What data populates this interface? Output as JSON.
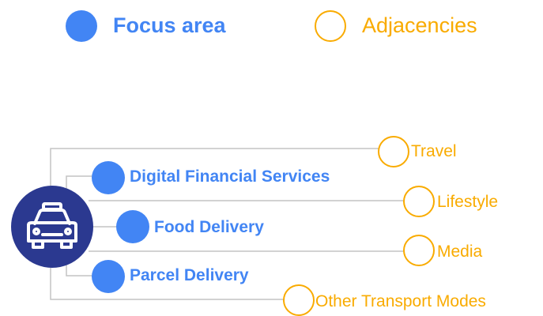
{
  "colors": {
    "focus": "#4285f4",
    "adjacent": "#f9ab00",
    "hub": "#2b3990",
    "lines": "#c4c4c4"
  },
  "legend": {
    "focus_label": "Focus area",
    "adjacent_label": "Adjacencies"
  },
  "hub": {
    "icon": "taxi-icon"
  },
  "focus_areas": [
    {
      "label": "Digital Financial Services"
    },
    {
      "label": "Food Delivery"
    },
    {
      "label": "Parcel Delivery"
    }
  ],
  "adjacencies": [
    {
      "label": "Travel"
    },
    {
      "label": "Lifestyle"
    },
    {
      "label": "Media"
    },
    {
      "label": "Other Transport Modes"
    }
  ]
}
